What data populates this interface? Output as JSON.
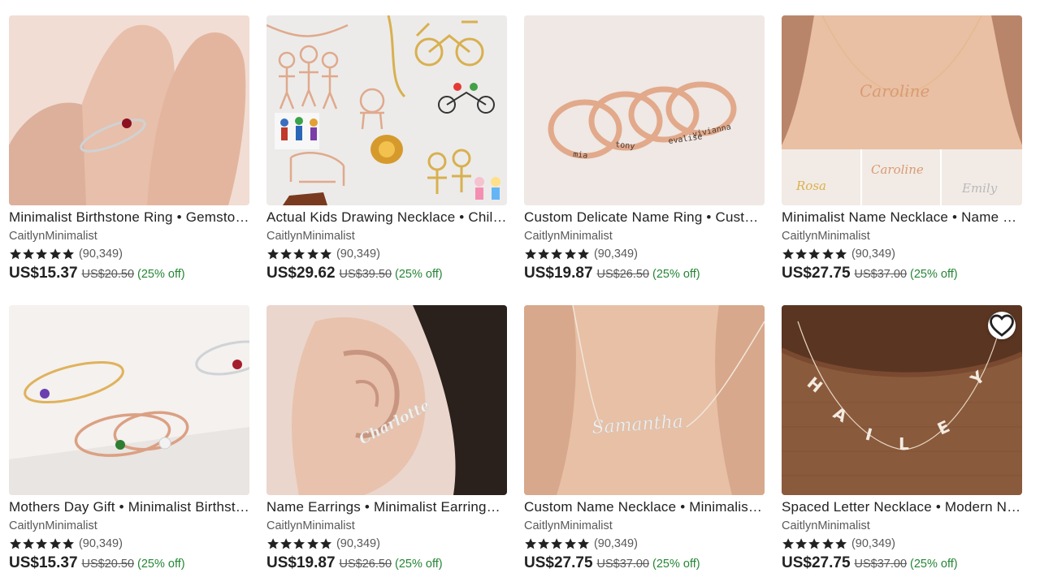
{
  "listings": [
    {
      "title": "Minimalist Birthstone Ring • Gemstone Ring • Dainty Ring",
      "shop": "CaitlynMinimalist",
      "rating_count": "(90,349)",
      "price": "US$15.37",
      "original_price": "US$20.50",
      "discount": "(25% off)",
      "image": "ring-on-finger",
      "favorited_button": false
    },
    {
      "title": "Actual Kids Drawing Necklace • Children Drawing Necklace",
      "shop": "CaitlynMinimalist",
      "rating_count": "(90,349)",
      "price": "US$29.62",
      "original_price": "US$39.50",
      "discount": "(25% off)",
      "image": "kids-drawing-necklaces",
      "favorited_button": false
    },
    {
      "title": "Custom Delicate Name Ring • Custom Stacking Ring",
      "shop": "CaitlynMinimalist",
      "rating_count": "(90,349)",
      "price": "US$19.87",
      "original_price": "US$26.50",
      "discount": "(25% off)",
      "image": "stacked-name-rings",
      "favorited_button": false
    },
    {
      "title": "Minimalist Name Necklace • Name Necklace Gold",
      "shop": "CaitlynMinimalist",
      "rating_count": "(90,349)",
      "price": "US$27.75",
      "original_price": "US$37.00",
      "discount": "(25% off)",
      "image": "name-necklace-caroline",
      "favorited_button": false
    },
    {
      "title": "Mothers Day Gift • Minimalist Birthstone Ring",
      "shop": "CaitlynMinimalist",
      "rating_count": "(90,349)",
      "price": "US$15.37",
      "original_price": "US$20.50",
      "discount": "(25% off)",
      "image": "birthstone-rings",
      "favorited_button": false
    },
    {
      "title": "Name Earrings • Minimalist Earrings • Custom Earrings",
      "shop": "CaitlynMinimalist",
      "rating_count": "(90,349)",
      "price": "US$19.87",
      "original_price": "US$26.50",
      "discount": "(25% off)",
      "image": "name-earring-charlotte",
      "favorited_button": false
    },
    {
      "title": "Custom Name Necklace • Minimalist Necklace • Gift",
      "shop": "CaitlynMinimalist",
      "rating_count": "(90,349)",
      "price": "US$27.75",
      "original_price": "US$37.00",
      "discount": "(25% off)",
      "image": "name-necklace-samantha",
      "favorited_button": false
    },
    {
      "title": "Spaced Letter Necklace • Modern Name Necklace",
      "shop": "CaitlynMinimalist",
      "rating_count": "(90,349)",
      "price": "US$27.75",
      "original_price": "US$37.00",
      "discount": "(25% off)",
      "image": "letter-necklace-hailey",
      "favorited_button": true
    }
  ],
  "image_text": {
    "ring_names": [
      "mia",
      "tony",
      "evalise",
      "vivianna"
    ],
    "necklace_name": "Caroline",
    "necklace_names_strip": [
      "Rosa",
      "Caroline",
      "Emily"
    ],
    "earring_name": "Charlotte",
    "necklace_name_2": "Samantha",
    "letters": [
      "H",
      "A",
      "I",
      "L",
      "E",
      "Y"
    ]
  },
  "icons": {
    "star": "star-icon",
    "favorite": "heart-outline-icon"
  },
  "colors": {
    "star": "#222222",
    "discount": "#258635",
    "gold": "#e0b25c",
    "rose_gold": "#dba083"
  }
}
